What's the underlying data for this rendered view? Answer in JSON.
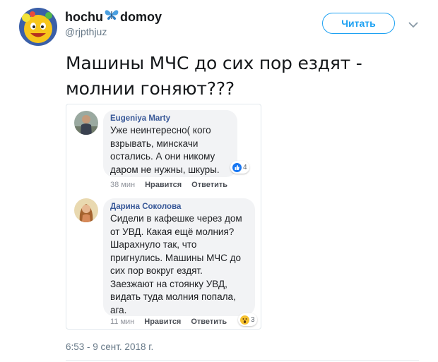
{
  "header": {
    "name_part1": "hochu",
    "name_part2": "domoy",
    "handle": "@rjpthjuz",
    "follow_label": "Читать"
  },
  "tweet": {
    "lines": [
      "Машины МЧС до сих пор ездят -",
      "молнии гоняют???"
    ],
    "timestamp": "6:53 - 9 сент. 2018 г."
  },
  "comments": [
    {
      "author": "Eugeniya Marty",
      "lines": [
        "Уже неинтересно( кого",
        "взрывать, минскачи",
        "остались. А они никому",
        "даром не нужны, шкуры."
      ],
      "reaction_count": "4",
      "time": "38 мин",
      "like": "Нравится",
      "reply": "Ответить"
    },
    {
      "author": "Дарина Соколова",
      "lines": [
        "Сидели в кафешке через дом",
        "от УВД. Какая ещё молния?",
        "Шарахнуло так, что",
        "пригнулись. Машины МЧС до",
        "сих пор вокруг ездят.",
        "Заезжают на стоянку УВД,",
        "видать туда молния попала,",
        "ага."
      ],
      "reaction_count": "3",
      "time": "11 мин",
      "like": "Нравится",
      "reply": "Ответить"
    }
  ],
  "colors": {
    "accent": "#1da1f2",
    "fb_name": "#385898",
    "bubble": "#f2f3f5"
  },
  "icons": [
    "emoji-avatar",
    "butterfly-icon",
    "chevron-down-icon",
    "like-reaction-icon",
    "wow-reaction-icon"
  ]
}
